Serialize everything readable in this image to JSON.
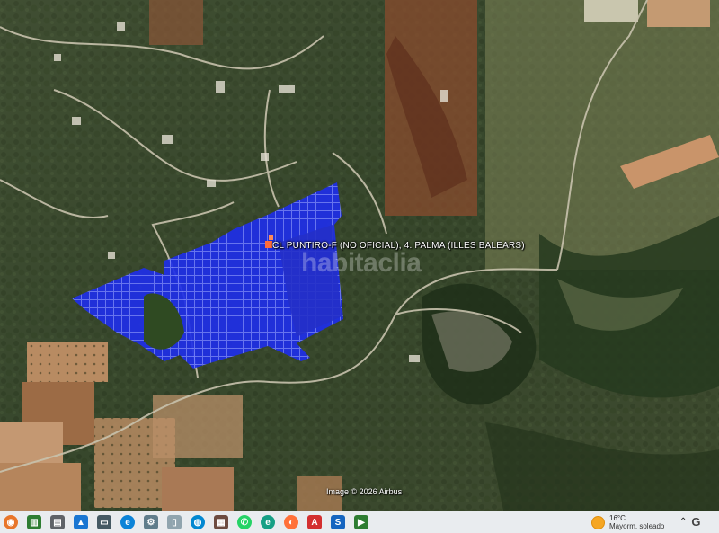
{
  "map": {
    "view": "satellite",
    "location_label": "CL PUNTIRO-F (NO OFICIAL), 4. PALMA (ILLES BALEARS)",
    "watermark": "habitaclia",
    "imagery_credit": "Image © 2026 Airbus",
    "parcel_highlight_color": "#1f2ee6"
  },
  "taskbar": {
    "icons": [
      {
        "name": "start-icon",
        "color": "#e8762b"
      },
      {
        "name": "dashboard-icon",
        "color": "#2e7d32"
      },
      {
        "name": "printer-icon",
        "color": "#5f6368"
      },
      {
        "name": "photos-icon",
        "color": "#1976d2"
      },
      {
        "name": "screen-icon",
        "color": "#455a64"
      },
      {
        "name": "edge-icon",
        "color": "#0b84d8"
      },
      {
        "name": "settings-icon",
        "color": "#607d8b"
      },
      {
        "name": "document-icon",
        "color": "#90a4ae"
      },
      {
        "name": "globe-icon",
        "color": "#0288d1"
      },
      {
        "name": "files-icon",
        "color": "#6d4c41"
      },
      {
        "name": "whatsapp-icon",
        "color": "#25d366"
      },
      {
        "name": "edge-green-icon",
        "color": "#16a085"
      },
      {
        "name": "firefox-icon",
        "color": "#ff7139"
      },
      {
        "name": "acrobat-icon",
        "color": "#d32f2f"
      },
      {
        "name": "paint-icon",
        "color": "#1565c0"
      },
      {
        "name": "presentation-icon",
        "color": "#2e7d32"
      }
    ],
    "weather": {
      "temperature": "16°C",
      "condition": "Mayorm. soleado"
    }
  }
}
